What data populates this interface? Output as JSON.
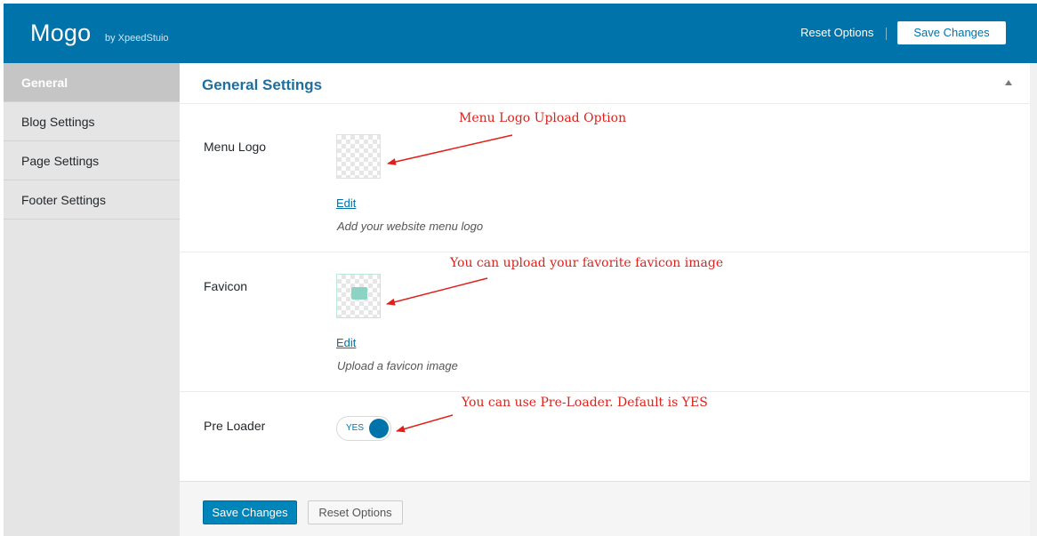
{
  "header": {
    "brand": "Mogo",
    "by": "by XpeedStuio",
    "reset_label": "Reset Options",
    "save_label": "Save Changes"
  },
  "sidebar": {
    "items": [
      {
        "label": "General",
        "active": true
      },
      {
        "label": "Blog Settings"
      },
      {
        "label": "Page Settings"
      },
      {
        "label": "Footer Settings"
      }
    ]
  },
  "main": {
    "title": "General Settings",
    "fields": {
      "menu_logo": {
        "label": "Menu Logo",
        "edit": "Edit",
        "description": "Add your website menu logo"
      },
      "favicon": {
        "label": "Favicon",
        "edit": "Edit",
        "description": "Upload a favicon image"
      },
      "pre_loader": {
        "label": "Pre Loader",
        "toggle_text": "YES"
      }
    },
    "annotations": {
      "menu_logo": "Menu Logo Upload Option",
      "favicon": "You can upload your favorite favicon image",
      "pre_loader": "You can use Pre-Loader. Default is YES"
    }
  },
  "footer": {
    "save_label": "Save Changes",
    "reset_label": "Reset Options"
  },
  "colors": {
    "header_bg": "#0073aa",
    "accent": "#0073aa",
    "annotation": "#e0201a"
  }
}
